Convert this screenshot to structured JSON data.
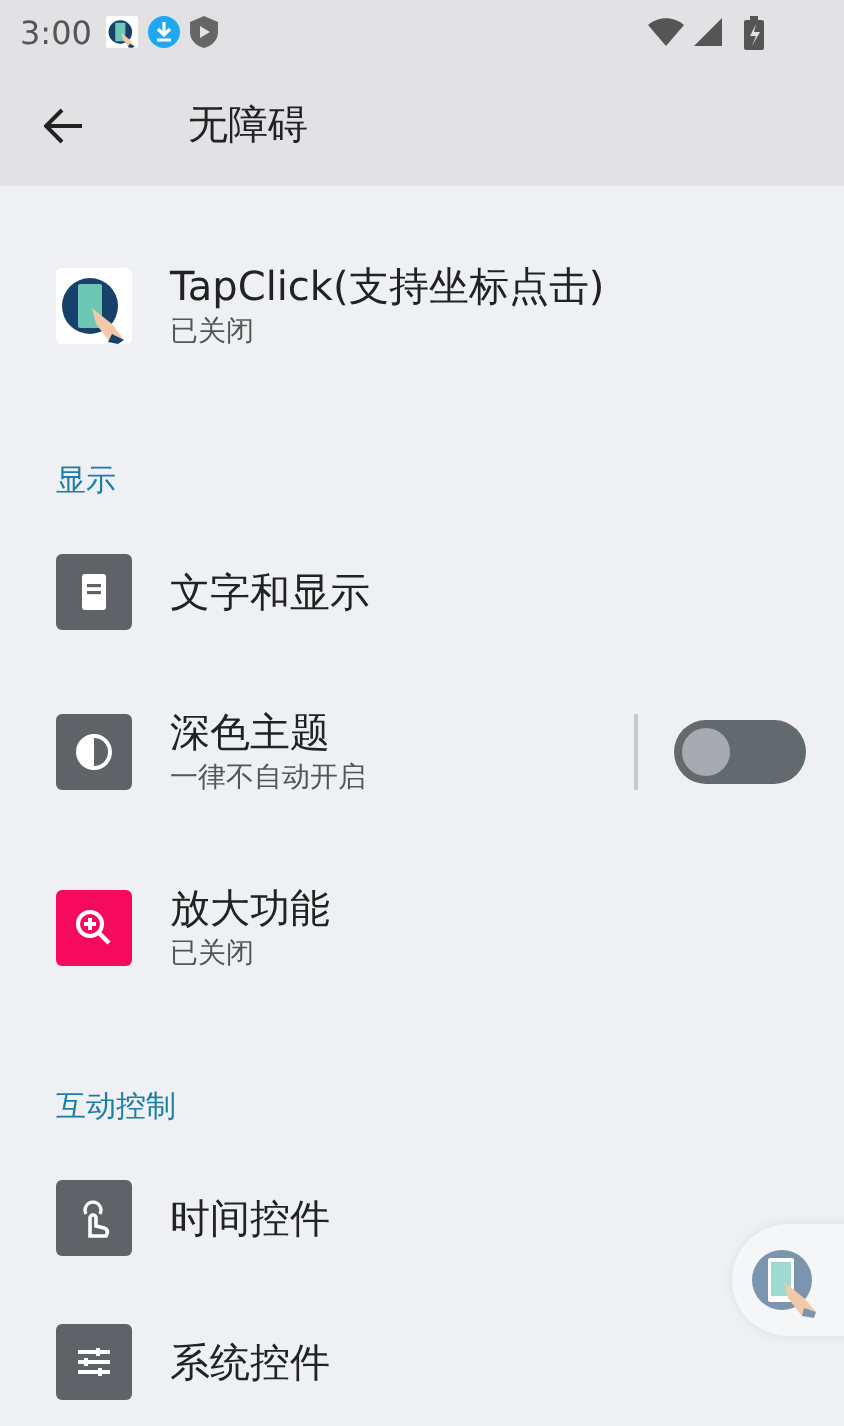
{
  "status_bar": {
    "time": "3:00"
  },
  "app_bar": {
    "title": "无障碍"
  },
  "sections": [
    {
      "items": [
        {
          "kind": "app",
          "title": "TapClick(支持坐标点击)",
          "subtitle": "已关闭"
        }
      ]
    },
    {
      "header": "显示",
      "items": [
        {
          "kind": "plain",
          "title": "文字和显示"
        },
        {
          "kind": "toggle",
          "title": "深色主题",
          "subtitle": "一律不自动开启",
          "on": false
        },
        {
          "kind": "plain",
          "title": "放大功能",
          "subtitle": "已关闭"
        }
      ]
    },
    {
      "header": "互动控制",
      "items": [
        {
          "kind": "plain",
          "title": "时间控件"
        },
        {
          "kind": "plain",
          "title": "系统控件"
        }
      ]
    }
  ]
}
